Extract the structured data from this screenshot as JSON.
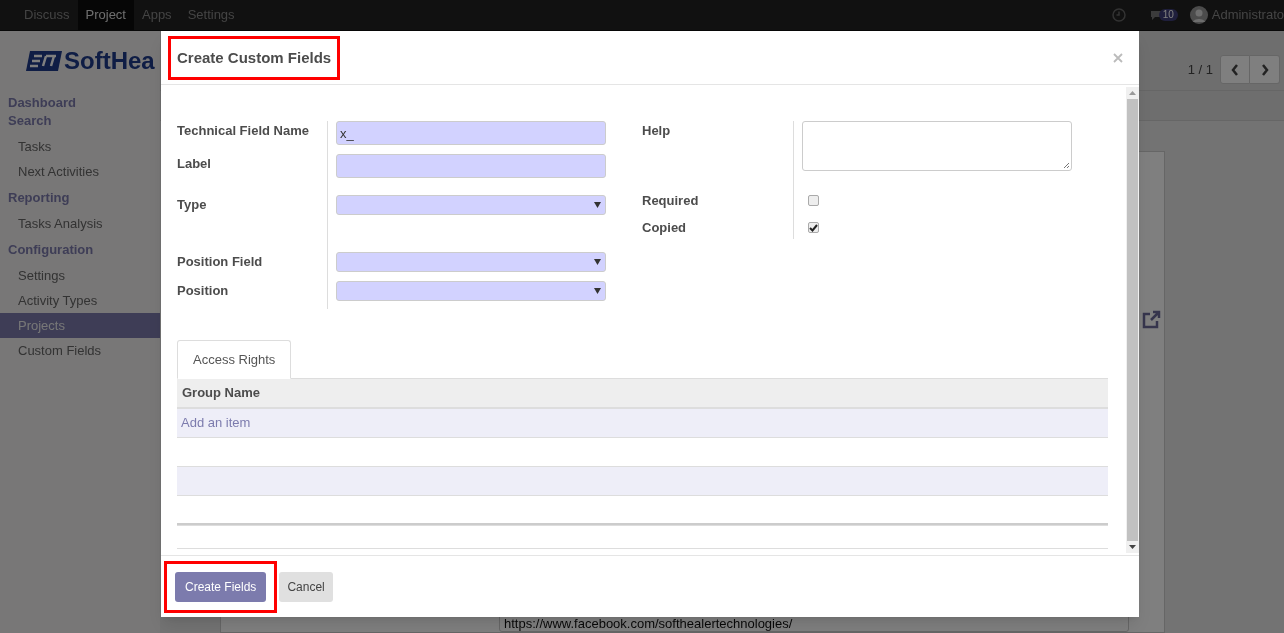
{
  "navbar": {
    "apps": [
      {
        "label": "Discuss",
        "selected": false
      },
      {
        "label": "Project",
        "selected": true
      },
      {
        "label": "Apps",
        "selected": false
      },
      {
        "label": "Settings",
        "selected": false
      }
    ],
    "message_count": "10",
    "user": "Administrato"
  },
  "brand": {
    "text": "SoftHea"
  },
  "sidebar": {
    "sections": [
      {
        "title": "Dashboard"
      },
      {
        "title": "Search",
        "items": [
          {
            "label": "Tasks",
            "selected": false
          },
          {
            "label": "Next Activities",
            "selected": false
          }
        ]
      },
      {
        "title": "Reporting",
        "items": [
          {
            "label": "Tasks Analysis",
            "selected": false
          }
        ]
      },
      {
        "title": "Configuration",
        "items": [
          {
            "label": "Settings",
            "selected": false
          },
          {
            "label": "Activity Types",
            "selected": false
          },
          {
            "label": "Projects",
            "selected": true
          },
          {
            "label": "Custom Fields",
            "selected": false
          }
        ]
      }
    ]
  },
  "pager": {
    "text": "1 / 1"
  },
  "background_url": "https://www.facebook.com/softhealertechnologies/",
  "dialog": {
    "title": "Create Custom Fields",
    "title_highlighted": true,
    "left_fields": [
      {
        "label": "Technical Field Name",
        "kind": "input",
        "value": "x_"
      },
      {
        "label": "Label",
        "kind": "input"
      },
      {
        "label": "Type",
        "kind": "select"
      },
      {
        "label": "Position Field",
        "kind": "select"
      },
      {
        "label": "Position",
        "kind": "select"
      }
    ],
    "right_fields": [
      {
        "label": "Help",
        "kind": "textarea"
      },
      {
        "label": "Required",
        "kind": "checkbox",
        "checked": false
      },
      {
        "label": "Copied",
        "kind": "checkbox",
        "checked": true
      }
    ],
    "tabs": [
      {
        "label": "Access Rights",
        "selected": true
      }
    ],
    "table": {
      "columns": [
        "Group Name"
      ],
      "add_link": "Add an item"
    },
    "buttons": [
      {
        "label": "Create Fields",
        "kind": "primary",
        "highlighted": true
      },
      {
        "label": "Cancel",
        "kind": "secondary",
        "highlighted": false
      }
    ]
  }
}
